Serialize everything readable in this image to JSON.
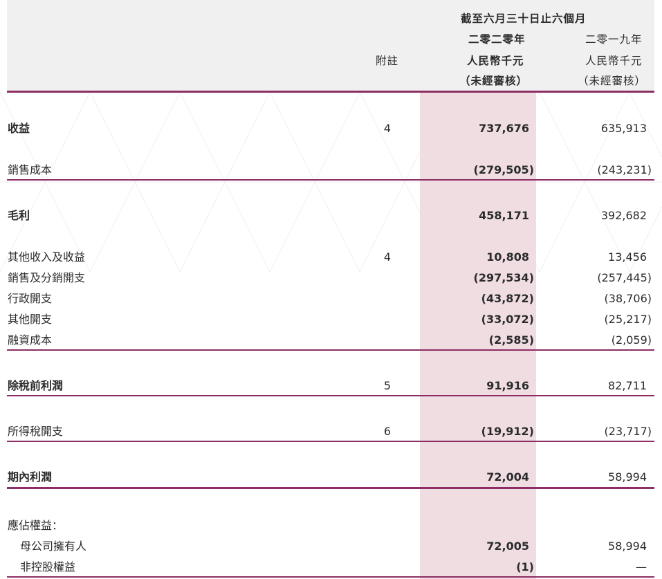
{
  "header": {
    "period_heading": "截至六月三十日止六個月",
    "note_label": "附註",
    "current": {
      "year": "二零二零年",
      "currency": "人民幣千元",
      "audit": "（未經審核）"
    },
    "previous": {
      "year": "二零一九年",
      "currency": "人民幣千元",
      "audit": "（未經審核）"
    }
  },
  "rows": [
    {
      "label": "收益",
      "note": "4",
      "current": "737,676",
      "previous": "635,913"
    },
    {
      "label": "銷售成本",
      "note": "",
      "current": "(279,505)",
      "previous": "(243,231)"
    },
    {
      "label": "毛利",
      "note": "",
      "current": "458,171",
      "previous": "392,682"
    },
    {
      "label": "其他收入及收益",
      "note": "4",
      "current": "10,808",
      "previous": "13,456"
    },
    {
      "label": "銷售及分銷開支",
      "note": "",
      "current": "(297,534)",
      "previous": "(257,445)"
    },
    {
      "label": "行政開支",
      "note": "",
      "current": "(43,872)",
      "previous": "(38,706)"
    },
    {
      "label": "其他開支",
      "note": "",
      "current": "(33,072)",
      "previous": "(25,217)"
    },
    {
      "label": "融資成本",
      "note": "",
      "current": "(2,585)",
      "previous": "(2,059)"
    },
    {
      "label": "除稅前利潤",
      "note": "5",
      "current": "91,916",
      "previous": "82,711"
    },
    {
      "label": "所得稅開支",
      "note": "6",
      "current": "(19,912)",
      "previous": "(23,717)"
    },
    {
      "label": "期內利潤",
      "note": "",
      "current": "72,004",
      "previous": "58,994"
    },
    {
      "label": "應佔權益：",
      "note": "",
      "current": "",
      "previous": ""
    },
    {
      "label": "母公司擁有人",
      "note": "",
      "current": "72,005",
      "previous": "58,994"
    },
    {
      "label": "非控股權益",
      "note": "",
      "current": "(1)",
      "previous": "—"
    }
  ],
  "colors": {
    "accent_rule": "#8c2d63",
    "highlight": "#efdde2",
    "header_bg": "#f1f0f0"
  }
}
